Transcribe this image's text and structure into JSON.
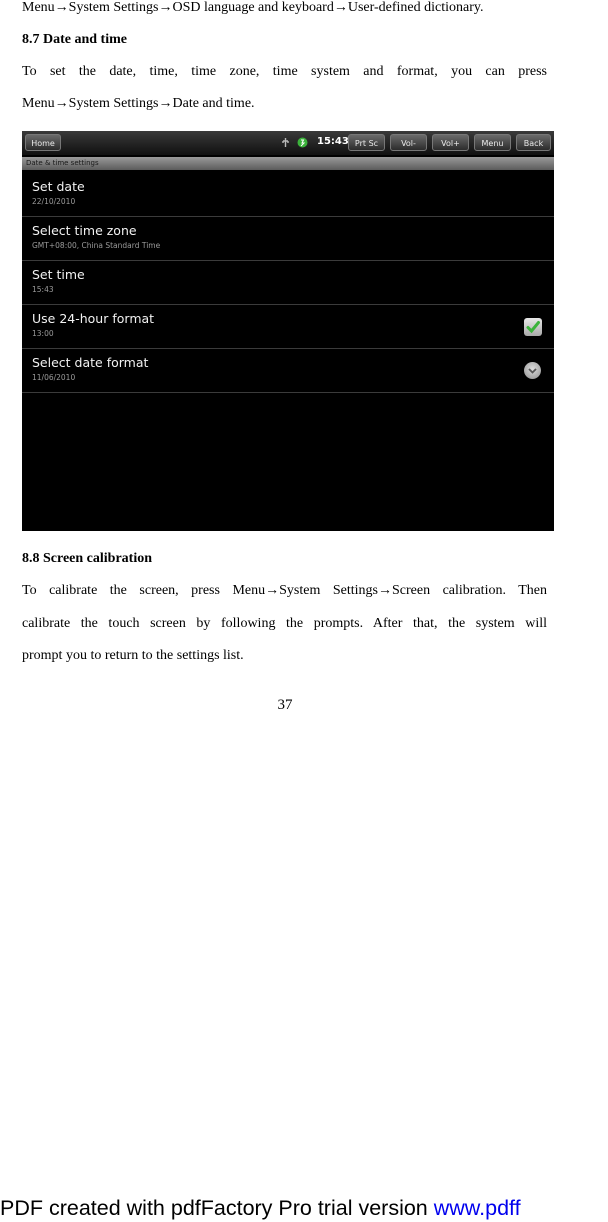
{
  "doc": {
    "line_top": "Menu→System Settings→OSD language and keyboard→User-defined dictionary.",
    "h_87": "8.7 Date and time",
    "p87_l1": "To set the date, time, time zone, time system and format, you can press",
    "p87_l2": "Menu→System Settings→Date and time.",
    "h_88": "8.8 Screen calibration",
    "p88_l1": "To calibrate the screen, press Menu→System Settings→Screen calibration. Then",
    "p88_l2": "calibrate the touch screen by following the prompts. After that, the system will",
    "p88_l3": "prompt you to return to the settings list.",
    "page_number": "37"
  },
  "screenshot": {
    "home_button": "Home",
    "clock": "15:43",
    "buttons": [
      "Prt Sc",
      "Vol-",
      "Vol+",
      "Menu",
      "Back"
    ],
    "title": "Date & time settings",
    "rows": [
      {
        "title": "Set date",
        "sub": "22/10/2010",
        "control": "none"
      },
      {
        "title": "Select time zone",
        "sub": "GMT+08:00, China Standard Time",
        "control": "none"
      },
      {
        "title": "Set time",
        "sub": "15:43",
        "control": "none"
      },
      {
        "title": "Use 24-hour format",
        "sub": "13:00",
        "control": "checkbox",
        "checked": true
      },
      {
        "title": "Select date format",
        "sub": "11/06/2010",
        "control": "dropdown"
      }
    ],
    "accent": "#3bb33b"
  },
  "footer": {
    "prefix": "PDF created with pdfFactory Pro trial version ",
    "link": "www.pdff"
  }
}
